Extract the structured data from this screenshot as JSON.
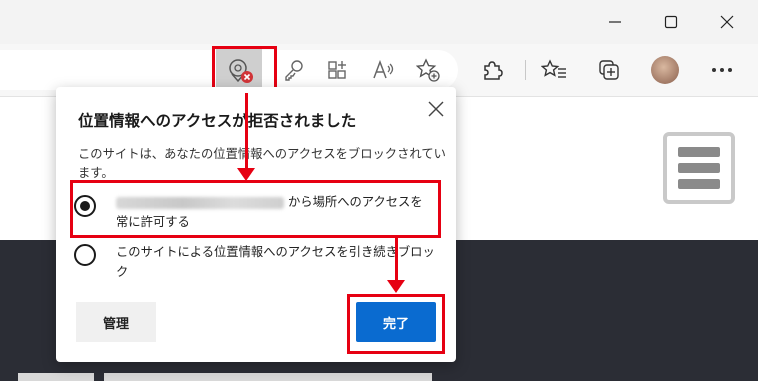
{
  "browser": {
    "window_controls": [
      "minimize",
      "maximize",
      "close"
    ],
    "toolbar_icons": [
      "location-blocked-icon",
      "key-icon",
      "apps-icon",
      "read-aloud-icon",
      "add-favorite-icon",
      "extensions-icon",
      "favorites-icon",
      "collections-icon",
      "profile-avatar",
      "more-icon"
    ]
  },
  "popup": {
    "title": "位置情報へのアクセスが拒否されました",
    "description": "このサイトは、あなたの位置情報へのアクセスをブロックされています。",
    "option_allow": {
      "text_line1": "から場所へのアクセスを",
      "text_line2": "常に許可する",
      "selected": true
    },
    "option_block": {
      "text": "このサイトによる位置情報へのアクセスを引き続きブロック",
      "selected": false
    },
    "manage_label": "管理",
    "done_label": "完了"
  },
  "colors": {
    "highlight": "#e60012",
    "accent_button": "#0a6bd0",
    "page_dark": "#2b2d35"
  }
}
